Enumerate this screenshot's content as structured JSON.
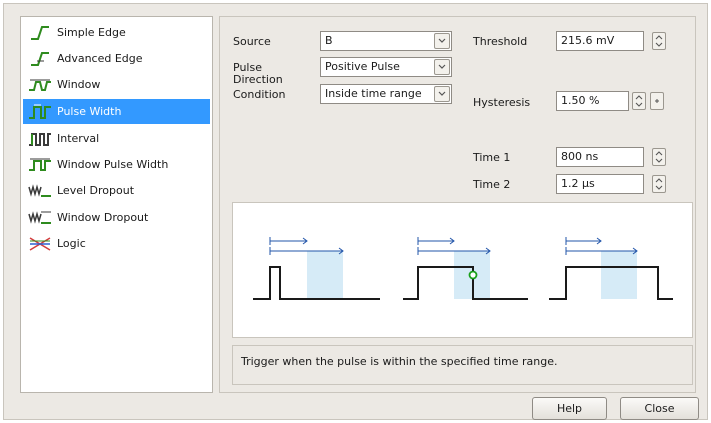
{
  "trigger_types": [
    {
      "label": "Simple Edge",
      "icon": "simple-edge-icon",
      "selected": false
    },
    {
      "label": "Advanced Edge",
      "icon": "advanced-edge-icon",
      "selected": false
    },
    {
      "label": "Window",
      "icon": "window-icon",
      "selected": false
    },
    {
      "label": "Pulse Width",
      "icon": "pulse-width-icon",
      "selected": true
    },
    {
      "label": "Interval",
      "icon": "interval-icon",
      "selected": false
    },
    {
      "label": "Window Pulse Width",
      "icon": "window-pulse-width-icon",
      "selected": false
    },
    {
      "label": "Level Dropout",
      "icon": "level-dropout-icon",
      "selected": false
    },
    {
      "label": "Window Dropout",
      "icon": "window-dropout-icon",
      "selected": false
    },
    {
      "label": "Logic",
      "icon": "logic-icon",
      "selected": false
    }
  ],
  "fields": {
    "source_label": "Source",
    "source_value": "B",
    "pulse_direction_label_1": "Pulse",
    "pulse_direction_label_2": "Direction",
    "pulse_direction_value": "Positive Pulse",
    "condition_label": "Condition",
    "condition_value": "Inside time range",
    "threshold_label": "Threshold",
    "threshold_value": "215.6 mV",
    "hysteresis_label": "Hysteresis",
    "hysteresis_value": "1.50 %",
    "time1_label": "Time 1",
    "time1_value": "800 ns",
    "time2_label": "Time 2",
    "time2_value": "1.2 µs"
  },
  "description": "Trigger when the pulse is within the specified time range.",
  "buttons": {
    "help": "Help",
    "close": "Close"
  },
  "colors": {
    "selection": "#3399ff",
    "icon_green": "#2e8b1e",
    "icon_dark": "#3a3a3a",
    "window_fill": "#d6ebf7",
    "marker_blue": "#2255aa",
    "trigger_point": "#1aa01a"
  }
}
